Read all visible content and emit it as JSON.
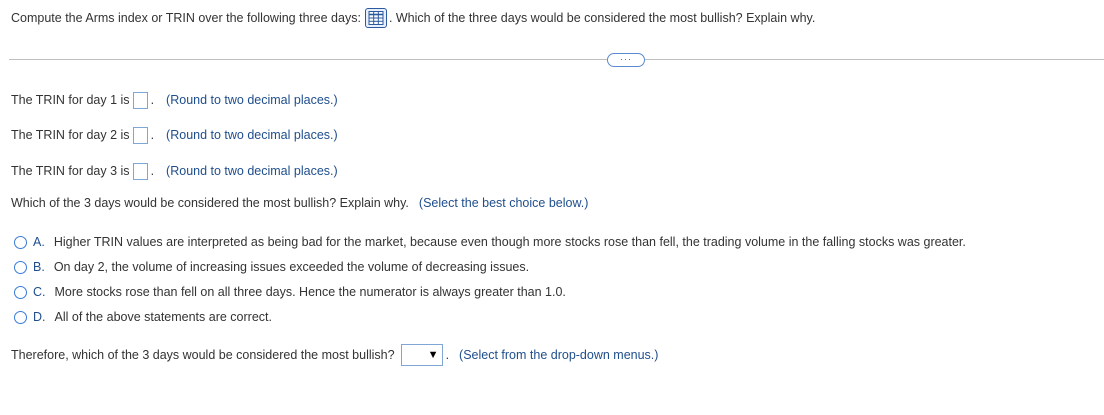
{
  "question": {
    "prompt_part1": "Compute the Arms index or TRIN over the following three days:",
    "prompt_part2": ". Which of the three days would be considered the most bullish? Explain why.",
    "more_button": "···"
  },
  "trin_rows": [
    {
      "label": "The TRIN for day 1 is",
      "hint": "(Round to two decimal places.)"
    },
    {
      "label": "The TRIN for day 2 is",
      "hint": "(Round to two decimal places.)"
    },
    {
      "label": "The TRIN for day 3 is",
      "hint": "(Round to two decimal places.)"
    }
  ],
  "choice_prompt": {
    "text": "Which of the 3 days would be considered the most bullish? Explain why.",
    "hint": "(Select the best choice below.)"
  },
  "options": [
    {
      "letter": "A.",
      "text": "Higher TRIN values are interpreted as being bad for the market, because even though more stocks rose than fell, the trading volume in the falling stocks was greater."
    },
    {
      "letter": "B.",
      "text": "On day 2, the volume of increasing issues exceeded the volume of decreasing issues."
    },
    {
      "letter": "C.",
      "text": "More stocks rose than fell on all three days. Hence the numerator is always greater than 1.0."
    },
    {
      "letter": "D.",
      "text": "All of the above statements are correct."
    }
  ],
  "final": {
    "text": "Therefore, which of the 3 days would be considered the most bullish?",
    "hint": "(Select from the drop-down menus.)"
  },
  "icons": {
    "table": "table-icon",
    "dropdown_arrow": "dropdown-arrow-icon"
  }
}
